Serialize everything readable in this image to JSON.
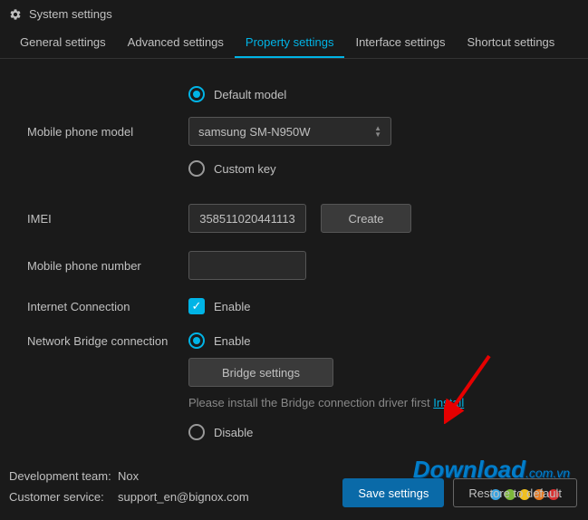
{
  "header": {
    "title": "System settings"
  },
  "tabs": {
    "general": "General settings",
    "advanced": "Advanced settings",
    "property": "Property settings",
    "interface": "Interface settings",
    "shortcut": "Shortcut settings"
  },
  "model": {
    "label": "Mobile phone model",
    "default_label": "Default model",
    "custom_label": "Custom key",
    "select_value": "samsung SM-N950W"
  },
  "imei": {
    "label": "IMEI",
    "value": "358511020441113",
    "create": "Create"
  },
  "phone": {
    "label": "Mobile phone number",
    "value": ""
  },
  "internet": {
    "label": "Internet Connection",
    "enable": "Enable"
  },
  "bridge": {
    "label": "Network Bridge connection",
    "enable": "Enable",
    "settings": "Bridge settings",
    "hint": "Please install the Bridge connection driver first ",
    "install": "Install",
    "disable": "Disable"
  },
  "footer": {
    "dev_label": "Development team:",
    "dev_value": "Nox",
    "support_label": "Customer service:",
    "support_value": "support_en@bignox.com",
    "save": "Save settings",
    "restore": "Restore to default"
  },
  "watermark": {
    "text": "Download",
    "ext": ".com.vn"
  }
}
